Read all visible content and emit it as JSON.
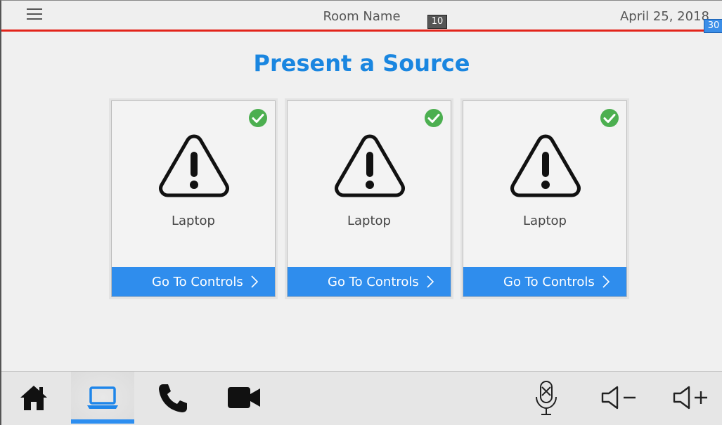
{
  "header": {
    "room_name": "Room Name",
    "date": "April 25, 2018",
    "badge_left": "10",
    "badge_right": "30"
  },
  "main": {
    "title": "Present a Source",
    "sources": [
      {
        "label": "Laptop",
        "button_label": "Go To Controls",
        "status": "selected",
        "icon": "warning-icon"
      },
      {
        "label": "Laptop",
        "button_label": "Go To Controls",
        "status": "selected",
        "icon": "warning-icon"
      },
      {
        "label": "Laptop",
        "button_label": "Go To Controls",
        "status": "selected",
        "icon": "warning-icon"
      }
    ]
  },
  "footer": {
    "buttons": [
      {
        "icon": "home-icon"
      },
      {
        "icon": "laptop-icon",
        "active": true
      },
      {
        "icon": "phone-icon"
      },
      {
        "icon": "video-camera-icon"
      },
      {
        "icon": "microphone-mute-icon"
      },
      {
        "icon": "volume-down-icon"
      },
      {
        "icon": "volume-up-icon"
      }
    ]
  },
  "colors": {
    "accent": "#2f8ded",
    "title": "#1a86e0",
    "header_line": "#e3241b",
    "check": "#4caf50"
  }
}
